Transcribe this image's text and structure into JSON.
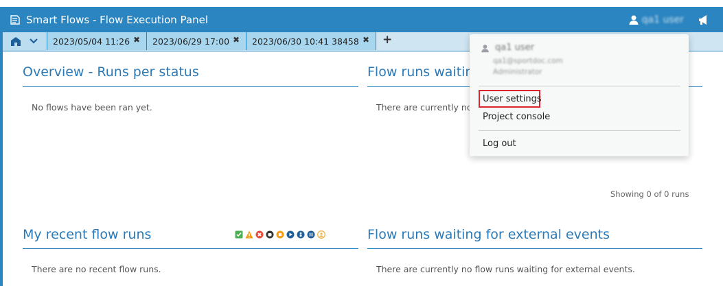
{
  "app": {
    "title": "Smart Flows - Flow Execution Panel"
  },
  "header": {
    "user_name": "qa1 user"
  },
  "tabs": [
    {
      "label": "2023/05/04 11:26"
    },
    {
      "label": "2023/06/29 17:00"
    },
    {
      "label": "2023/06/30 10:41 38458"
    }
  ],
  "add_tab_label": "+",
  "close_glyph": "✖",
  "sections": {
    "overview": {
      "title": "Overview - Runs per status",
      "empty_text": "No flows have been ran yet."
    },
    "waiting": {
      "title": "Flow runs waiting",
      "empty_text": "There are currently no",
      "footer": "Showing 0 of 0 runs"
    },
    "recent": {
      "title": "My recent flow runs",
      "empty_text": "There are no recent flow runs."
    },
    "external": {
      "title": "Flow runs waiting for external events",
      "empty_text": "There are currently no flow runs waiting for external events."
    }
  },
  "status_filters": [
    {
      "name": "completed-icon",
      "color": "#4caf50"
    },
    {
      "name": "warning-icon",
      "color": "#f39c12"
    },
    {
      "name": "error-icon",
      "color": "#e74c3c"
    },
    {
      "name": "hand-icon",
      "color": "#333333"
    },
    {
      "name": "stop-icon",
      "color": "#f39c12"
    },
    {
      "name": "play-icon",
      "color": "#1f5f99"
    },
    {
      "name": "pending-icon",
      "color": "#1f5f99"
    },
    {
      "name": "pause-icon",
      "color": "#1f5f99"
    },
    {
      "name": "user-wait-icon",
      "color": "#f0b34a"
    }
  ],
  "user_menu": {
    "name": "qa1 user",
    "email": "qa1@sportdoc.com",
    "role": "Administrator",
    "items": {
      "settings": "User settings",
      "console": "Project console",
      "logout": "Log out"
    }
  },
  "colors": {
    "brand": "#2b85c0",
    "tab_active": "#a8d6ee",
    "highlight": "#d9262d"
  }
}
